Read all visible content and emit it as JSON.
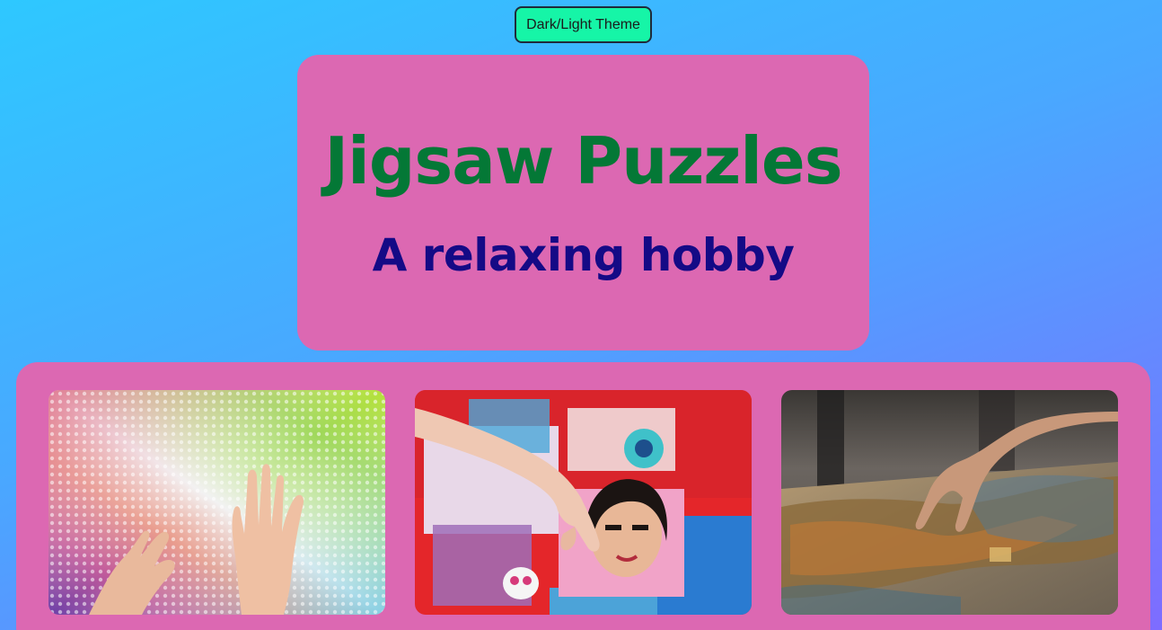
{
  "theme_toggle": {
    "label": "Dark/Light Theme"
  },
  "hero": {
    "title": "Jigsaw Puzzles",
    "subtitle": "A relaxing hobby"
  },
  "gallery": {
    "photos": [
      {
        "name": "rainbow-puzzle-pieces-photo"
      },
      {
        "name": "portrait-puzzle-photo"
      },
      {
        "name": "table-puzzle-photo"
      }
    ]
  },
  "colors": {
    "button_bg": "#16f5a7",
    "panel_bg": "#dc68b2",
    "title": "#047836",
    "subtitle": "#140a86"
  }
}
